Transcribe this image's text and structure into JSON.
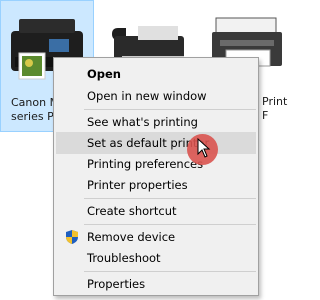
{
  "devices": [
    {
      "label_line1": "Canon M",
      "label_line2": "series Pr"
    },
    {
      "label_line1": "Print",
      "label_line2": "F"
    }
  ],
  "context_menu": {
    "items": [
      {
        "label": "Open",
        "bold": true
      },
      {
        "label": "Open in new window"
      },
      {
        "label": "See what's printing"
      },
      {
        "label": "Set as default printer",
        "highlighted": true
      },
      {
        "label": "Printing preferences"
      },
      {
        "label": "Printer properties"
      },
      {
        "label": "Create shortcut"
      },
      {
        "label": "Remove device",
        "icon": "shield-icon"
      },
      {
        "label": "Troubleshoot"
      },
      {
        "label": "Properties"
      }
    ]
  },
  "colors": {
    "selected_tile": "#cce8ff",
    "menu_background": "#f0f0f0",
    "menu_highlight": "#dadada",
    "cursor_highlight": "#d9534f"
  }
}
